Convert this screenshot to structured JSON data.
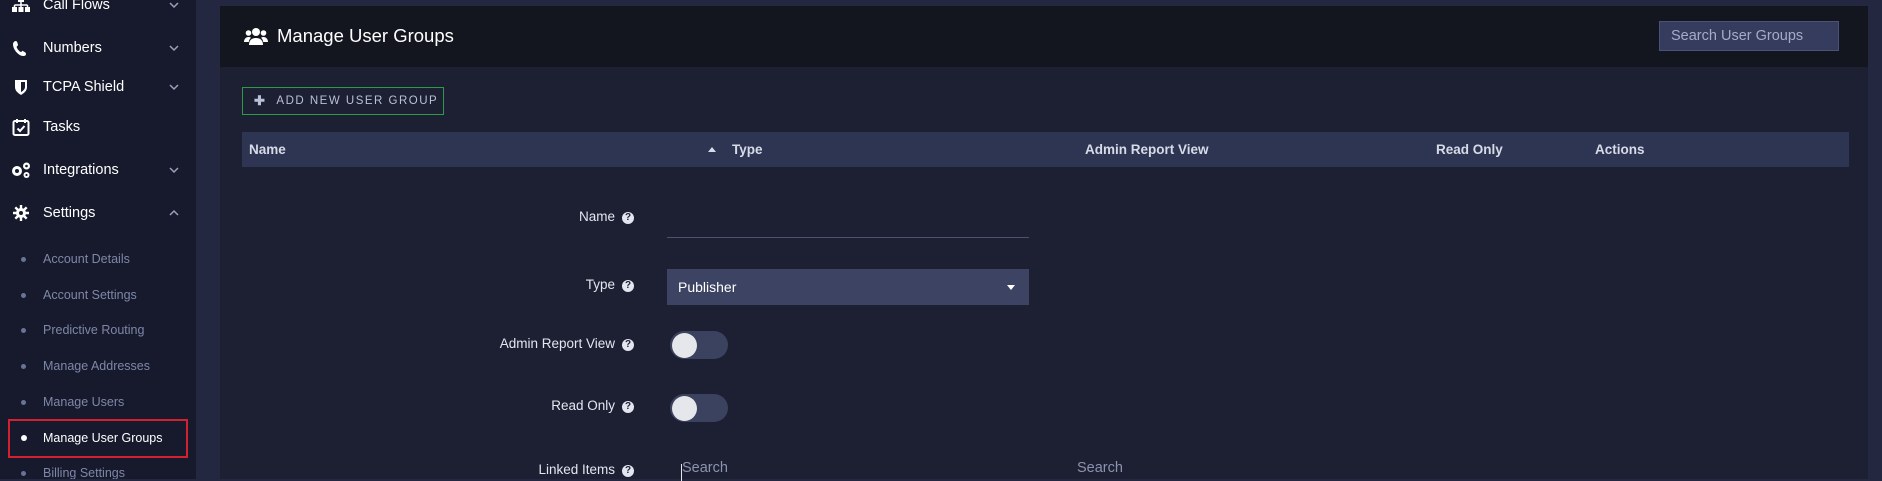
{
  "sidebar": {
    "nav": [
      {
        "label": "Call Flows",
        "icon": "sitemap-icon",
        "has_chevron": true,
        "expanded": false
      },
      {
        "label": "Numbers",
        "icon": "phone-icon",
        "has_chevron": true,
        "expanded": false
      },
      {
        "label": "TCPA Shield",
        "icon": "shield-icon",
        "has_chevron": true,
        "expanded": false
      },
      {
        "label": "Tasks",
        "icon": "calendar-check-icon",
        "has_chevron": false
      },
      {
        "label": "Integrations",
        "icon": "cogs-icon",
        "has_chevron": true,
        "expanded": false
      },
      {
        "label": "Settings",
        "icon": "gear-icon",
        "has_chevron": true,
        "expanded": true
      }
    ],
    "settings_sub": [
      {
        "label": "Account Details",
        "active": false
      },
      {
        "label": "Account Settings",
        "active": false
      },
      {
        "label": "Predictive Routing",
        "active": false
      },
      {
        "label": "Manage Addresses",
        "active": false
      },
      {
        "label": "Manage Users",
        "active": false
      },
      {
        "label": "Manage User Groups",
        "active": true
      },
      {
        "label": "Billing Settings",
        "active": false
      }
    ]
  },
  "header": {
    "title": "Manage User Groups",
    "icon": "users-icon",
    "search_placeholder": "Search User Groups"
  },
  "toolbar": {
    "add_label": "ADD NEW USER GROUP"
  },
  "table": {
    "columns": [
      "Name",
      "Type",
      "Admin Report View",
      "Read Only",
      "Actions"
    ],
    "sorted_column": "Name",
    "sort_direction": "ascending"
  },
  "form": {
    "name_label": "Name",
    "name_value": "",
    "type_label": "Type",
    "type_value": "Publisher",
    "admin_report_label": "Admin Report View",
    "admin_report_on": false,
    "read_only_label": "Read Only",
    "read_only_on": false,
    "linked_items_label": "Linked Items",
    "linked_search_left": "Search",
    "linked_search_right": "Search"
  },
  "colors": {
    "accent_green": "#2e9a48",
    "highlight_red": "#d3222e",
    "sidebar_bg": "#161a2c",
    "panel_bg": "#1d2032"
  }
}
